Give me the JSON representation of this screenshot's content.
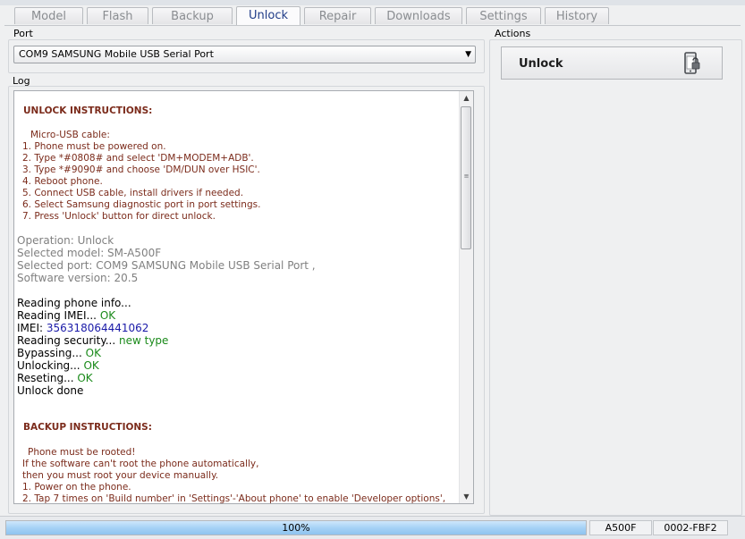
{
  "tabs": [
    {
      "label": "Model",
      "active": false
    },
    {
      "label": "Flash",
      "active": false
    },
    {
      "label": "Backup",
      "active": false
    },
    {
      "label": "Unlock",
      "active": true
    },
    {
      "label": "Repair",
      "active": false
    },
    {
      "label": "Downloads",
      "active": false
    },
    {
      "label": "Settings",
      "active": false
    },
    {
      "label": "History",
      "active": false
    }
  ],
  "port": {
    "group_label": "Port",
    "selected": "COM9 SAMSUNG Mobile USB Serial Port"
  },
  "log": {
    "group_label": "Log",
    "unlock_header": "UNLOCK INSTRUCTIONS:",
    "unlock_sub": "Micro-USB cable:",
    "unlock_steps": [
      "1. Phone must be powered on.",
      "2. Type *#0808# and select 'DM+MODEM+ADB'.",
      "3. Type *#9090# and choose 'DM/DUN over HSIC'.",
      "4. Reboot phone.",
      "5. Connect USB cable, install drivers if needed.",
      "6. Select Samsung diagnostic port in port settings.",
      "7. Press 'Unlock' button for direct unlock."
    ],
    "operation": "Operation: Unlock",
    "model": "Selected model: SM-A500F",
    "selected_port": "Selected port: COM9 SAMSUNG Mobile USB Serial Port ,",
    "software": "Software version: 20.5",
    "reading_info": "Reading phone info...",
    "reading_imei": "Reading IMEI...",
    "imei_label": "IMEI:",
    "imei_value": "356318064441062",
    "reading_security": "Reading security...",
    "security_value": "new type",
    "bypassing": "Bypassing...",
    "unlocking": "Unlocking...",
    "reseting": "Reseting...",
    "ok": "OK",
    "done": "Unlock done",
    "backup_header": "BACKUP INSTRUCTIONS:",
    "backup_lines": [
      "Phone must be rooted!",
      "If the software can't root the phone automatically,",
      "then you must root your device manually.",
      "1. Power on the phone.",
      "2. Tap 7 times on 'Build number' in 'Settings'-'About phone' to enable 'Developer options',"
    ]
  },
  "actions": {
    "group_label": "Actions",
    "unlock_button": "Unlock",
    "icon": "phone-unlock-icon"
  },
  "status": {
    "progress": 1.0,
    "progress_text": "100%",
    "model": "A500F",
    "code": "0002-FBF2"
  },
  "colors": {
    "instruction_text": "#7b2b1b",
    "ok": "#1a8a1a",
    "imei": "#1a1aa8",
    "progress": "#a6d2f6"
  }
}
